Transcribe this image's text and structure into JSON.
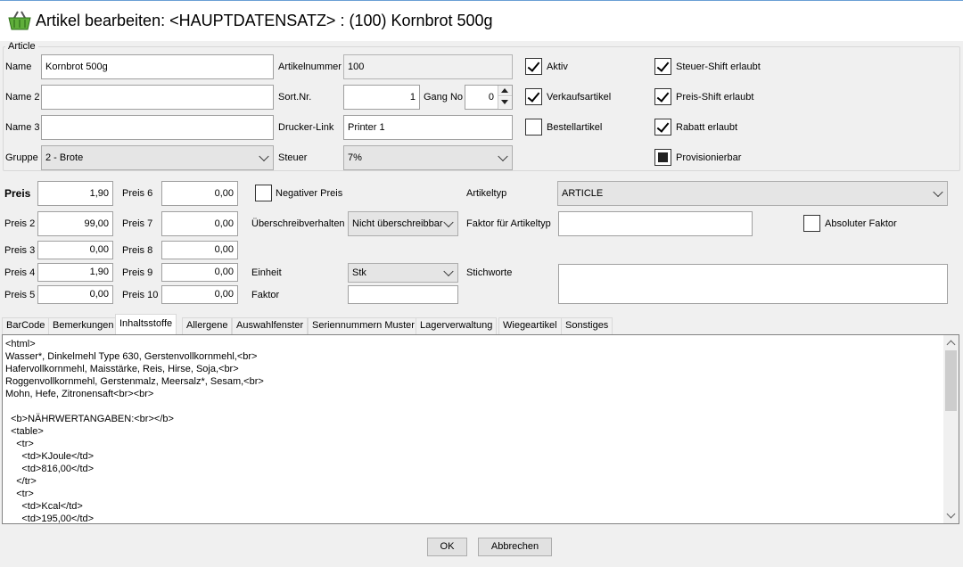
{
  "window": {
    "title": "Artikel bearbeiten: <HAUPTDATENSATZ> : (100) Kornbrot 500g",
    "icon": "basket-icon"
  },
  "article": {
    "legend": "Article",
    "name_label": "Name",
    "name_value": "Kornbrot 500g",
    "name2_label": "Name 2",
    "name2_value": "",
    "name3_label": "Name 3",
    "name3_value": "",
    "gruppe_label": "Gruppe",
    "gruppe_value": "2 - Brote",
    "artikelnummer_label": "Artikelnummer",
    "artikelnummer_value": "100",
    "sortnr_label": "Sort.Nr.",
    "sortnr_value": "1",
    "gangno_label": "Gang No",
    "gangno_value": "0",
    "drucker_label": "Drucker-Link",
    "drucker_value": "Printer 1",
    "steuer_label": "Steuer",
    "steuer_value": "7%",
    "aktiv_label": "Aktiv",
    "aktiv_checked": true,
    "verkauf_label": "Verkaufsartikel",
    "verkauf_checked": true,
    "bestell_label": "Bestellartikel",
    "bestell_checked": false,
    "steuershift_label": "Steuer-Shift erlaubt",
    "steuershift_checked": true,
    "preisshift_label": "Preis-Shift erlaubt",
    "preisshift_checked": true,
    "rabatt_label": "Rabatt erlaubt",
    "rabatt_checked": true,
    "provision_label": "Provisionierbar",
    "provision_state": "indeterminate"
  },
  "prices": {
    "preis_label": "Preis",
    "preis_value": "1,90",
    "preis2_label": "Preis 2",
    "preis2_value": "99,00",
    "preis3_label": "Preis 3",
    "preis3_value": "0,00",
    "preis4_label": "Preis 4",
    "preis4_value": "1,90",
    "preis5_label": "Preis 5",
    "preis5_value": "0,00",
    "preis6_label": "Preis 6",
    "preis6_value": "0,00",
    "preis7_label": "Preis 7",
    "preis7_value": "0,00",
    "preis8_label": "Preis 8",
    "preis8_value": "0,00",
    "preis9_label": "Preis 9",
    "preis9_value": "0,00",
    "preis10_label": "Preis 10",
    "preis10_value": "0,00"
  },
  "options": {
    "negativ_label": "Negativer Preis",
    "negativ_checked": false,
    "ueberschreib_label": "Überschreibverhalten",
    "ueberschreib_value": "Nicht überschreibbar",
    "einheit_label": "Einheit",
    "einheit_value": "Stk",
    "faktor_label": "Faktor",
    "faktor_value": "",
    "artikeltyp_label": "Artikeltyp",
    "artikeltyp_value": "ARTICLE",
    "faktortyp_label": "Faktor für Artikeltyp",
    "faktortyp_value": "",
    "absolut_label": "Absoluter Faktor",
    "absolut_checked": false,
    "stichworte_label": "Stichworte",
    "stichworte_value": ""
  },
  "tabs": [
    {
      "label": "BarCode"
    },
    {
      "label": "Bemerkungen"
    },
    {
      "label": "Inhaltsstoffe",
      "active": true
    },
    {
      "label": "Allergene"
    },
    {
      "label": "Auswahlfenster"
    },
    {
      "label": "Seriennummern Muster"
    },
    {
      "label": "Lagerverwaltung"
    },
    {
      "label": "Wiegeartikel"
    },
    {
      "label": "Sonstiges"
    }
  ],
  "editor": {
    "content": "<html>\nWasser*, Dinkelmehl Type 630, Gerstenvollkornmehl,<br>\nHafervollkornmehl, Maisstärke, Reis, Hirse, Soja,<br>\nRoggenvollkornmehl, Gerstenmalz, Meersalz*, Sesam,<br>\nMohn, Hefe, Zitronensaft<br><br>\n\n  <b>NÄHRWERTANGABEN:<br></b>\n  <table>\n    <tr>\n      <td>KJoule</td>\n      <td>816,00</td>\n    </tr>\n    <tr>\n      <td>Kcal</td>\n      <td>195,00</td>"
  },
  "buttons": {
    "ok": "OK",
    "cancel": "Abbrechen"
  }
}
